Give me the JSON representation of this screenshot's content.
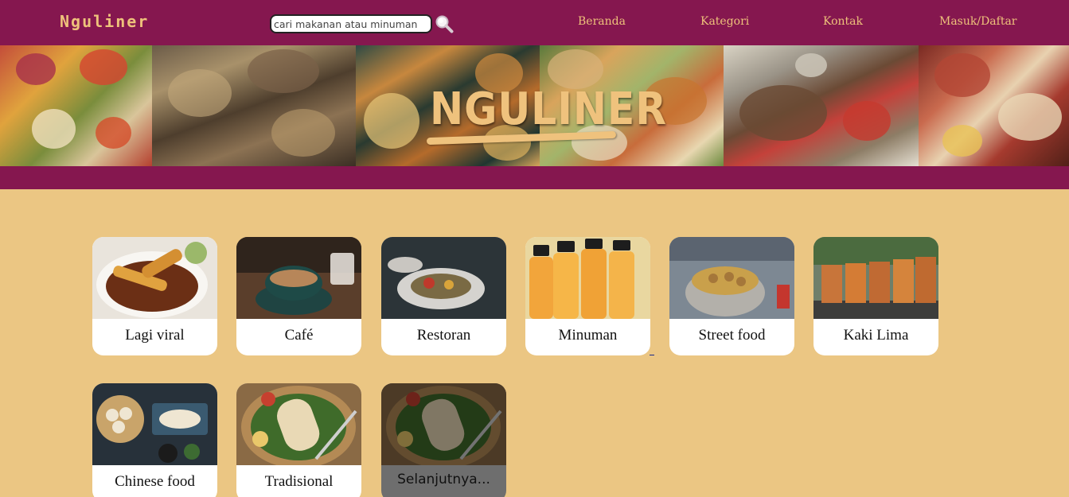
{
  "header": {
    "brand": "Nguliner",
    "search": {
      "placeholder": "cari makanan atau minuman",
      "icon": "search-icon"
    },
    "nav": [
      {
        "label": "Beranda"
      },
      {
        "label": "Kategori"
      },
      {
        "label": "Kontak"
      },
      {
        "label": "Masuk/Daftar"
      }
    ]
  },
  "banner": {
    "title": "NGULINER"
  },
  "categories": [
    {
      "label": "Lagi viral"
    },
    {
      "label": "Café"
    },
    {
      "label": "Restoran"
    },
    {
      "label": "Minuman"
    },
    {
      "label": "Street food"
    },
    {
      "label": "Kaki Lima"
    },
    {
      "label": "Chinese food"
    },
    {
      "label": "Tradisional"
    },
    {
      "label": "Selanjutnya..."
    }
  ],
  "colors": {
    "primary": "#85174f",
    "accent": "#eec27b",
    "background": "#ebc683"
  }
}
